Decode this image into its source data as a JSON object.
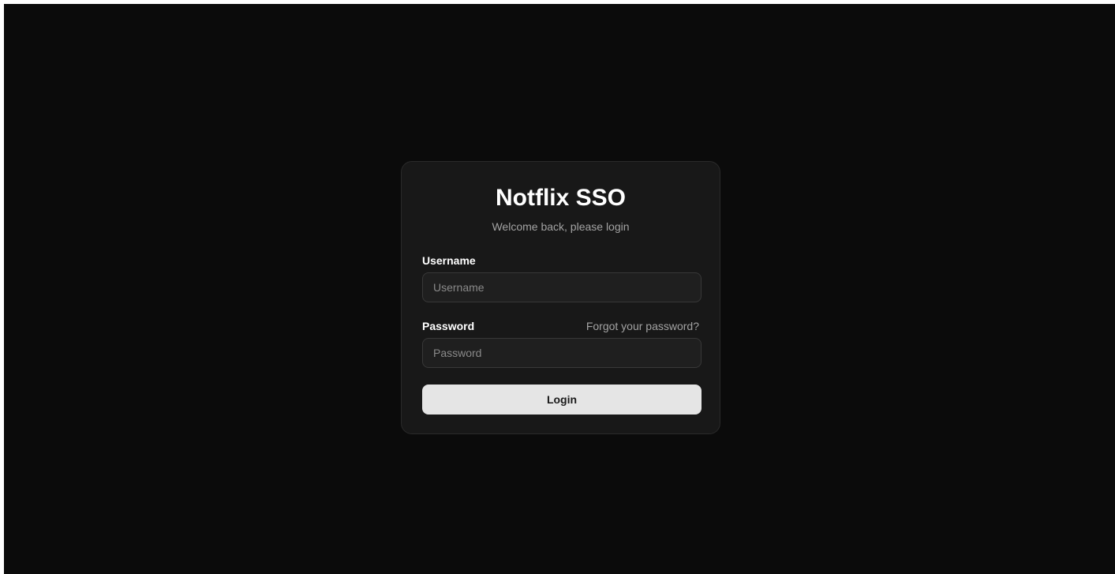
{
  "login": {
    "title": "Notflix SSO",
    "subtitle": "Welcome back, please login",
    "username": {
      "label": "Username",
      "placeholder": "Username",
      "value": ""
    },
    "password": {
      "label": "Password",
      "placeholder": "Password",
      "value": "",
      "forgot_link": "Forgot your password?"
    },
    "submit_label": "Login"
  },
  "colors": {
    "background": "#0b0b0b",
    "card": "#181818",
    "button": "#e5e5e5"
  }
}
